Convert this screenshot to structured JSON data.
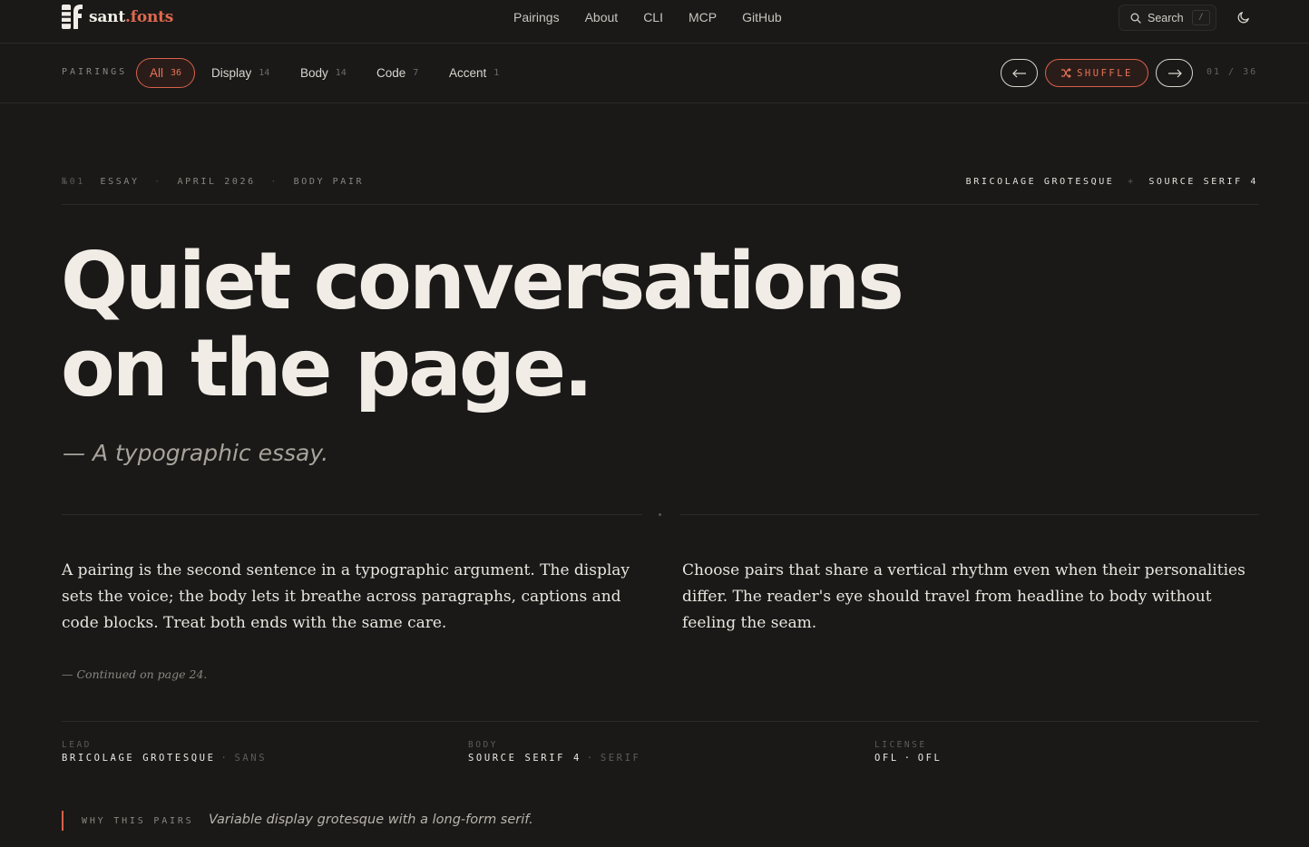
{
  "header": {
    "logo": {
      "name": "sant",
      "accent": ".fonts"
    },
    "nav": [
      "Pairings",
      "About",
      "CLI",
      "MCP",
      "GitHub"
    ],
    "search": {
      "label": "Search",
      "shortcut": "/"
    }
  },
  "filter_bar": {
    "label": "PAIRINGS",
    "filters": [
      {
        "label": "All",
        "count": "36",
        "active": true
      },
      {
        "label": "Display",
        "count": "14",
        "active": false
      },
      {
        "label": "Body",
        "count": "14",
        "active": false
      },
      {
        "label": "Code",
        "count": "7",
        "active": false
      },
      {
        "label": "Accent",
        "count": "1",
        "active": false
      }
    ],
    "shuffle_label": "SHUFFLE",
    "pager": "01 / 36"
  },
  "essay": {
    "meta": {
      "number": "№01",
      "kind": "ESSAY",
      "date": "APRIL 2026",
      "pair_type": "BODY PAIR"
    },
    "pairing": {
      "lead": "BRICOLAGE GROTESQUE",
      "body": "SOURCE SERIF 4"
    },
    "headline": {
      "line1": "Quiet conversations",
      "line2": "on the page."
    },
    "tagline": "— A typographic essay.",
    "paragraph_left": "A pairing is the second sentence in a typographic argument. The display sets the voice; the body lets it breathe across paragraphs, captions and code blocks. Treat both ends with the same care.",
    "paragraph_right": "Choose pairs that share a vertical rhythm even when their personalities differ. The reader's eye should travel from headline to body without feeling the seam.",
    "continued": "— Continued on page 24."
  },
  "specs": [
    {
      "label": "LEAD",
      "value": "BRICOLAGE GROTESQUE",
      "category": "SANS"
    },
    {
      "label": "BODY",
      "value": "SOURCE SERIF 4",
      "category": "SERIF"
    },
    {
      "label": "LICENSE",
      "value": "OFL",
      "category": "OFL"
    }
  ],
  "why": {
    "label": "WHY THIS PAIRS",
    "text": "Variable display grotesque with a long-form serif."
  },
  "colors": {
    "accent": "#e0694d",
    "background": "#1a1918",
    "text": "#f1ede6"
  },
  "icons": [
    "logo-mark-icon",
    "search-icon",
    "moon-icon",
    "arrow-left-icon",
    "shuffle-icon",
    "arrow-right-icon"
  ]
}
